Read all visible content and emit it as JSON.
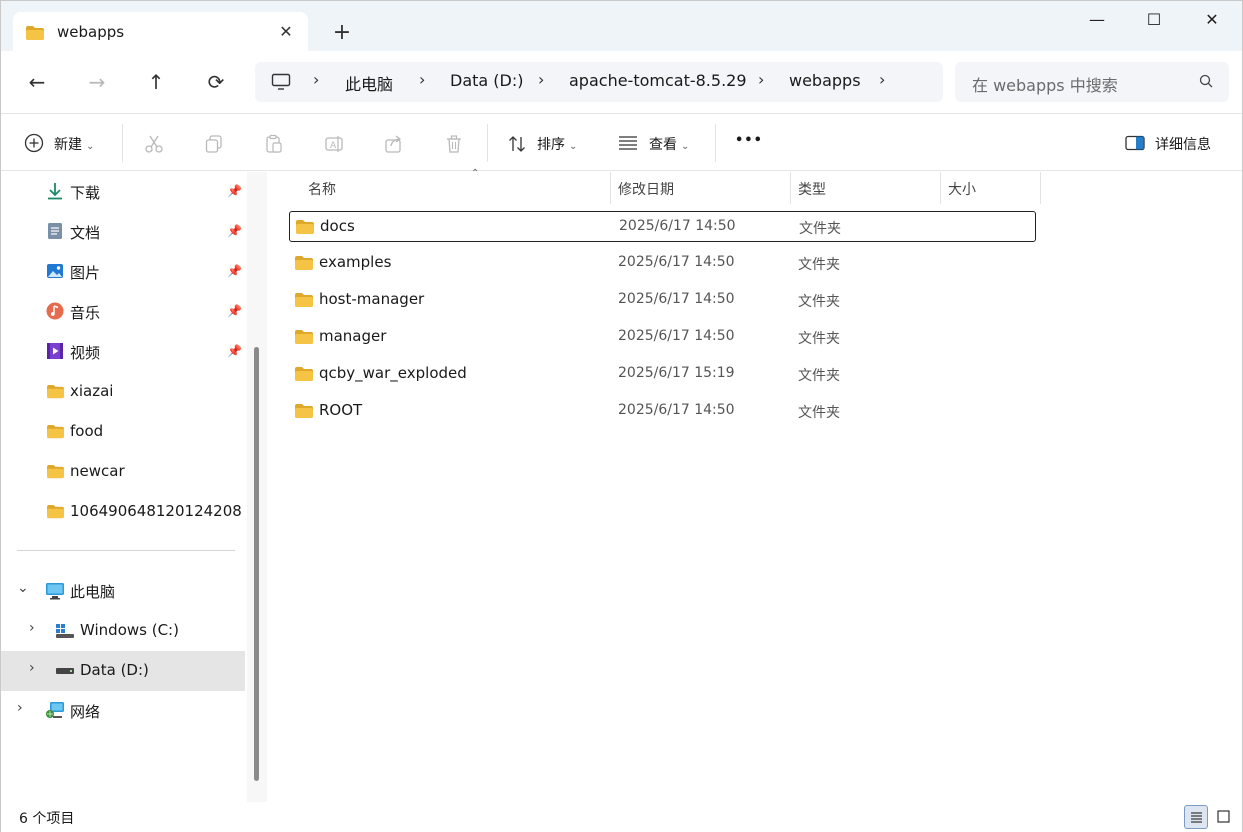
{
  "tab": {
    "title": "webapps",
    "close_glyph": "✕",
    "new_tab_glyph": "+"
  },
  "window_controls": {
    "minimize": "—",
    "maximize": "☐",
    "close": "✕"
  },
  "nav": {
    "back": "←",
    "forward": "→",
    "up": "↑",
    "refresh": "⟳"
  },
  "breadcrumb": [
    "此电脑",
    "Data (D:)",
    "apache-tomcat-8.5.29",
    "webapps"
  ],
  "search": {
    "placeholder": "在 webapps 中搜索"
  },
  "toolbar": {
    "new_label": "新建",
    "sort_label": "排序",
    "view_label": "查看",
    "more_label": "•••",
    "details_label": "详细信息",
    "icons": [
      "cut-icon",
      "copy-icon",
      "paste-icon",
      "rename-icon",
      "share-icon",
      "delete-icon"
    ]
  },
  "sidebar": {
    "quick_access": [
      {
        "label": "下载",
        "icon": "download-icon",
        "pinned": true
      },
      {
        "label": "文档",
        "icon": "documents-icon",
        "pinned": true
      },
      {
        "label": "图片",
        "icon": "pictures-icon",
        "pinned": true
      },
      {
        "label": "音乐",
        "icon": "music-icon",
        "pinned": true
      },
      {
        "label": "视频",
        "icon": "videos-icon",
        "pinned": true
      },
      {
        "label": "xiazai",
        "icon": "folder-icon",
        "pinned": false
      },
      {
        "label": "food",
        "icon": "folder-icon",
        "pinned": false
      },
      {
        "label": "newcar",
        "icon": "folder-icon",
        "pinned": false
      },
      {
        "label": "106490648120124208",
        "icon": "folder-icon",
        "pinned": false
      }
    ],
    "this_pc": {
      "label": "此电脑",
      "expanded": true
    },
    "drives": [
      {
        "label": "Windows (C:)",
        "selected": false
      },
      {
        "label": "Data (D:)",
        "selected": true
      }
    ],
    "network": {
      "label": "网络"
    }
  },
  "columns": {
    "name": "名称",
    "modified": "修改日期",
    "type": "类型",
    "size": "大小"
  },
  "files": [
    {
      "name": "docs",
      "modified": "2025/6/17 14:50",
      "type": "文件夹",
      "size": ""
    },
    {
      "name": "examples",
      "modified": "2025/6/17 14:50",
      "type": "文件夹",
      "size": ""
    },
    {
      "name": "host-manager",
      "modified": "2025/6/17 14:50",
      "type": "文件夹",
      "size": ""
    },
    {
      "name": "manager",
      "modified": "2025/6/17 14:50",
      "type": "文件夹",
      "size": ""
    },
    {
      "name": "qcby_war_exploded",
      "modified": "2025/6/17 15:19",
      "type": "文件夹",
      "size": ""
    },
    {
      "name": "ROOT",
      "modified": "2025/6/17 14:50",
      "type": "文件夹",
      "size": ""
    }
  ],
  "status": {
    "item_count": "6 个项目"
  },
  "colors": {
    "folder": "#f6c445",
    "folder_dark": "#e0a82a",
    "accent": "#0067c0",
    "selected": "#e5e5e5"
  }
}
